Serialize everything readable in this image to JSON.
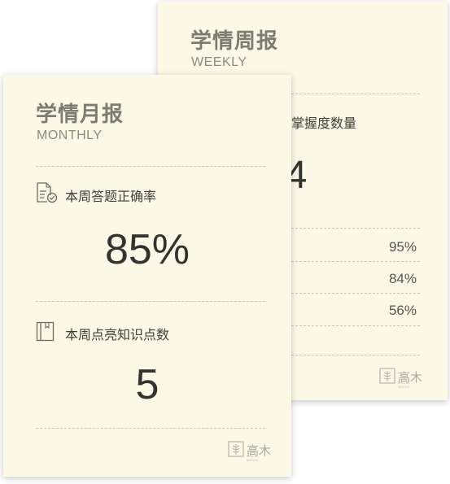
{
  "weekly": {
    "title": "学情周报",
    "subtitle": "WEEKLY",
    "section_label": "掌握度数量",
    "value": "4",
    "percentages": [
      "95%",
      "84%",
      "56%"
    ],
    "logo_text": "高木",
    "logo_sub": "GOLD-WOOD"
  },
  "monthly": {
    "title": "学情月报",
    "subtitle": "MONTHLY",
    "accuracy_label": "本周答题正确率",
    "accuracy_value": "85%",
    "knowledge_label": "本周点亮知识点数",
    "knowledge_value": "5",
    "logo_text": "高木",
    "logo_sub": "GOLD-WOOD"
  },
  "icons": {
    "accuracy": "document-check-icon",
    "knowledge": "book-icon",
    "logo": "leaf-logo-icon"
  }
}
